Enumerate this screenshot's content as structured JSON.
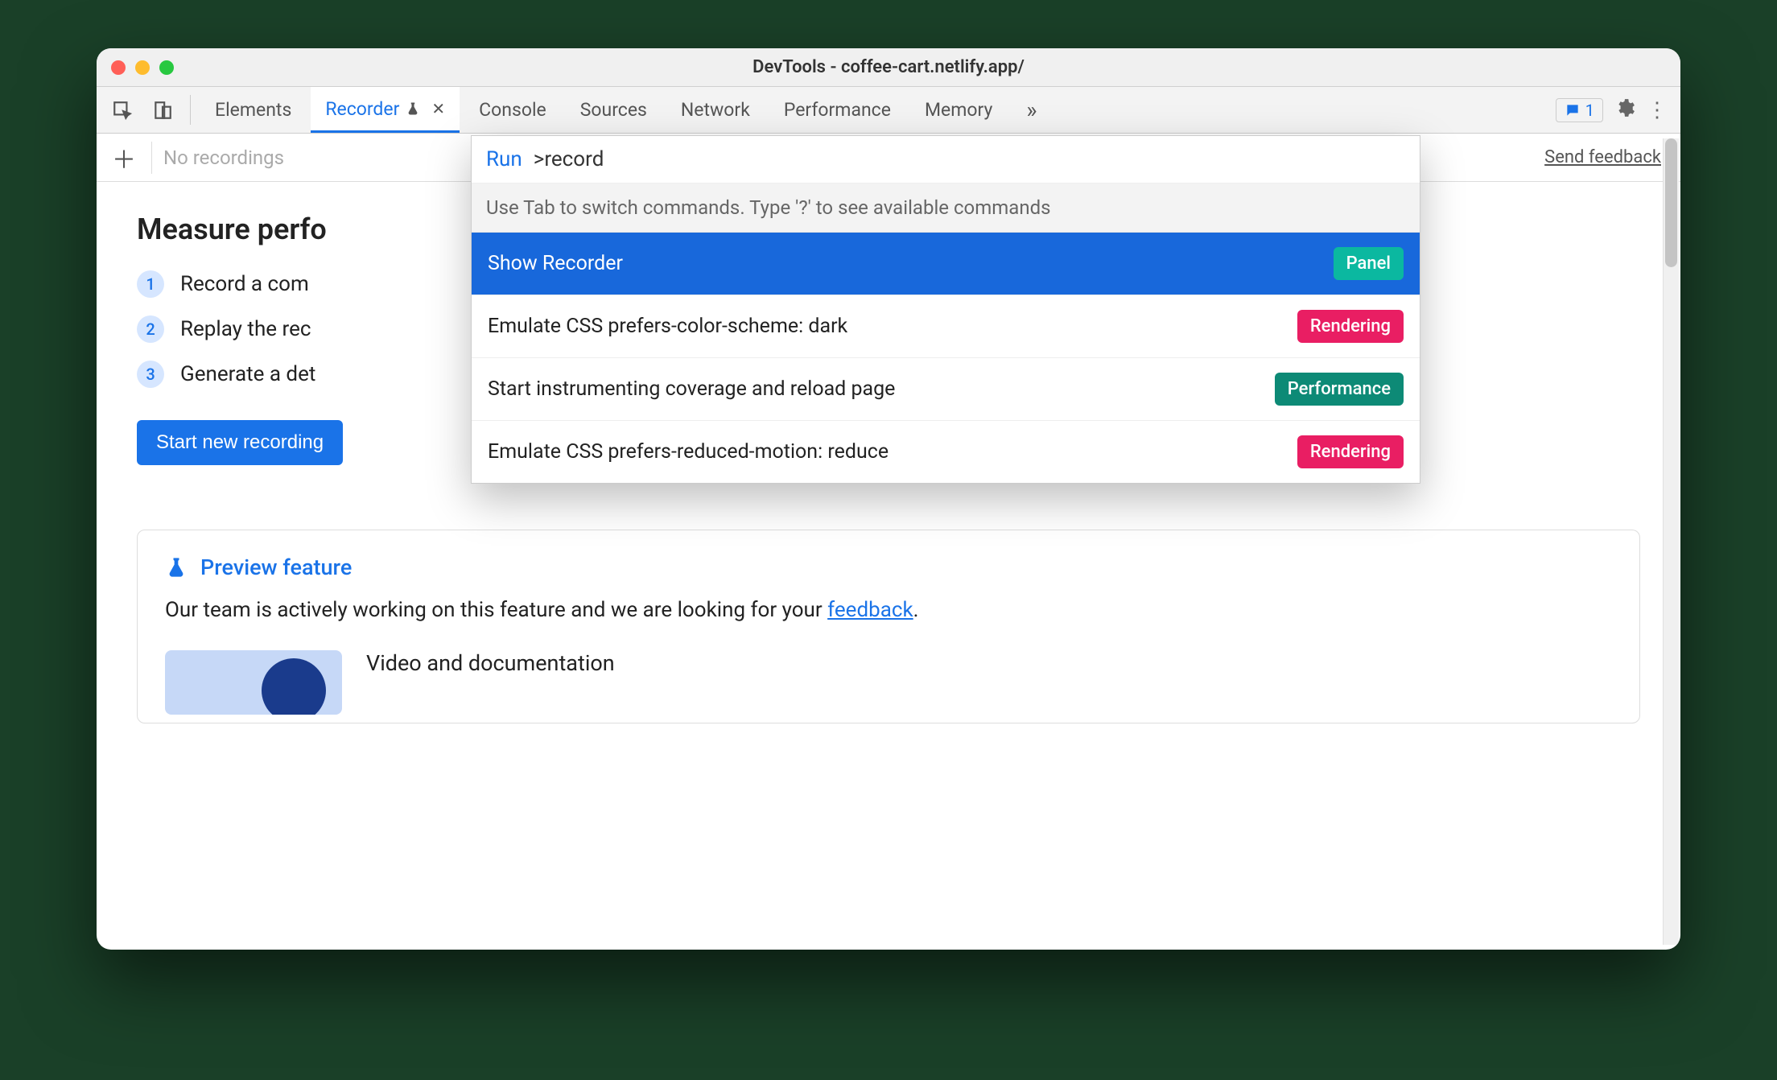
{
  "window": {
    "title": "DevTools - coffee-cart.netlify.app/"
  },
  "tabs": {
    "items": [
      "Elements",
      "Recorder",
      "Console",
      "Sources",
      "Network",
      "Performance",
      "Memory"
    ],
    "active_index": 1
  },
  "right_controls": {
    "chat_count": "1"
  },
  "subbar": {
    "placeholder": "No recordings",
    "feedback_link": "Send feedback"
  },
  "page": {
    "heading": "Measure perfo",
    "steps": [
      "Record a com",
      "Replay the rec",
      "Generate a det"
    ],
    "start_button": "Start new recording"
  },
  "card": {
    "preview_label": "Preview feature",
    "body_prefix": "Our team is actively working on this feature and we are looking for your ",
    "body_link": "feedback",
    "body_suffix": ".",
    "video_title": "Video and documentation"
  },
  "command_menu": {
    "run_label": "Run",
    "input_prefix": ">",
    "input_value": "record",
    "hint": "Use Tab to switch commands. Type '?' to see available commands",
    "items": [
      {
        "label": "Show Recorder",
        "badge": "Panel",
        "badge_style": "panel",
        "selected": true
      },
      {
        "label": "Emulate CSS prefers-color-scheme: dark",
        "badge": "Rendering",
        "badge_style": "rendering",
        "selected": false
      },
      {
        "label": "Start instrumenting coverage and reload page",
        "badge": "Performance",
        "badge_style": "perf",
        "selected": false
      },
      {
        "label": "Emulate CSS prefers-reduced-motion: reduce",
        "badge": "Rendering",
        "badge_style": "rendering",
        "selected": false
      }
    ]
  }
}
